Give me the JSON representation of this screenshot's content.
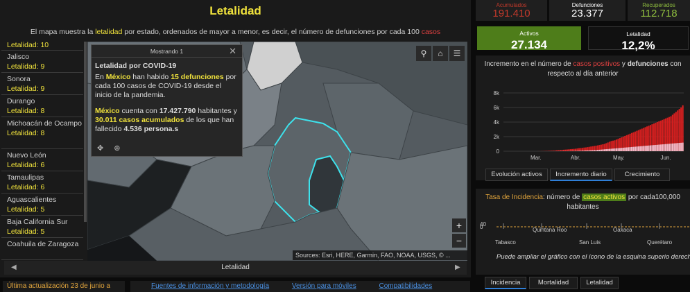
{
  "left": {
    "title": "Letalidad",
    "desc_pre": "El mapa muestra la ",
    "desc_hl": "letalidad",
    "desc_mid": " por estado, ordenados de mayor a menor, es decir, el número de defunciones por cada 100 ",
    "desc_red": "casos",
    "states": [
      {
        "name": "",
        "value": "Letalidad: 10"
      },
      {
        "name": "Jalisco",
        "value": "Letalidad: 9"
      },
      {
        "name": "Sonora",
        "value": "Letalidad: 9"
      },
      {
        "name": "Durango",
        "value": "Letalidad: 8"
      },
      {
        "name": "Michoacán de Ocampo",
        "value": "Letalidad: 8"
      },
      {
        "name": "Nuevo León",
        "value": "Letalidad: 6"
      },
      {
        "name": "Tamaulipas",
        "value": "Letalidad: 6"
      },
      {
        "name": "Aguascalientes",
        "value": "Letalidad: 5"
      },
      {
        "name": "Baja California Sur",
        "value": "Letalidad: 5"
      },
      {
        "name": "Coahuila de Zaragoza",
        "value": ""
      }
    ],
    "bottom_label": "Letalidad",
    "attribution": "Sources: Esri, HERE, Garmin, FAO, NOAA, USGS, © ..."
  },
  "popup": {
    "header": "Mostrando 1",
    "title": "Letalidad por COVID-19",
    "p1_a": "En ",
    "p1_place": "México",
    "p1_b": " han habido ",
    "p1_num": "15 defunciones",
    "p1_c": " por cada 100 casos de COVID-19 desde el inicio de la pandemia.",
    "p2_place": "México",
    "p2_a": " cuenta con ",
    "p2_pop": "17.427.790",
    "p2_b": " habitantes y ",
    "p2_cases": "30.011",
    "p2_cases_lbl": " casos acumulados",
    "p2_c": " de los que han ",
    "p2_d": "fallecido ",
    "p2_deaths": "4.536 persona.s"
  },
  "footer": {
    "update": "Última actualización 23 de junio a",
    "links": [
      "Fuentes de información y metodología",
      "Versión para móviles",
      "Compatibilidades"
    ]
  },
  "kpis": [
    {
      "label": "Acumulados",
      "value": "191.410",
      "color": "#c0392b"
    },
    {
      "label": "Defunciones",
      "value": "23.377",
      "color": "#ffffff"
    },
    {
      "label": "Recuperados",
      "value": "112.718",
      "color": "#8fbf3f"
    }
  ],
  "activos": {
    "label": "Activos",
    "value": "27.134",
    "color": "#4e7d1a"
  },
  "letalidad_box": {
    "label": "Letalidad",
    "value": "12,2%"
  },
  "chart_title": {
    "a": "Incremento  en el número de ",
    "red": "casos positivos",
    "b": " y ",
    "bold": "defunciones",
    "c": " con",
    "line2": "respecto al día anterior"
  },
  "chart_data": {
    "type": "bar",
    "yticks": [
      "8k",
      "6k",
      "4k",
      "2k",
      "0"
    ],
    "xticks": [
      "Mar.",
      "Abr.",
      "May.",
      "Jun."
    ],
    "ylim": [
      0,
      8000
    ],
    "series": [
      {
        "values": [
          0,
          0,
          0,
          0,
          0,
          0,
          0,
          0,
          0,
          0,
          0,
          0,
          0,
          0,
          0,
          0,
          0,
          0,
          0,
          0,
          5,
          10,
          15,
          20,
          30,
          40,
          50,
          60,
          70,
          80,
          100,
          120,
          140,
          160,
          180,
          200,
          220,
          240,
          260,
          280,
          300,
          320,
          340,
          380,
          420,
          440,
          460,
          500,
          520,
          560,
          600,
          640,
          680,
          720,
          760,
          800,
          850,
          900,
          950,
          1000,
          1100,
          1200,
          1300,
          1400,
          1450,
          1500,
          1600,
          1700,
          1800,
          1900,
          2000,
          2100,
          2200,
          2300,
          2400,
          2500,
          2600,
          2700,
          2800,
          2900,
          3000,
          3100,
          3200,
          3300,
          3400,
          3500,
          3600,
          3700,
          3800,
          3900,
          4000,
          4100,
          4200,
          4300,
          4400,
          4500,
          4600,
          4700,
          4800,
          5000,
          5200,
          5400,
          5600,
          5800,
          6000,
          6300
        ],
        "color": "#d41f1f"
      },
      {
        "values": [
          0,
          0,
          0,
          0,
          0,
          0,
          0,
          0,
          0,
          0,
          0,
          0,
          0,
          0,
          0,
          0,
          0,
          0,
          0,
          0,
          0,
          0,
          1,
          1,
          2,
          3,
          4,
          5,
          6,
          8,
          10,
          12,
          14,
          16,
          18,
          20,
          22,
          25,
          28,
          30,
          35,
          40,
          45,
          50,
          60,
          70,
          80,
          90,
          100,
          110,
          120,
          130,
          140,
          150,
          160,
          180,
          200,
          220,
          240,
          260,
          280,
          300,
          320,
          340,
          360,
          380,
          400,
          420,
          440,
          460,
          480,
          500,
          520,
          540,
          560,
          580,
          600,
          620,
          640,
          660,
          680,
          700,
          720,
          740,
          760,
          780,
          800,
          820,
          840,
          860,
          880,
          900,
          920,
          940,
          960,
          980,
          1000,
          1020,
          1040,
          1060,
          1080,
          1100,
          1120,
          1140,
          1160,
          1180
        ],
        "color": "#f2b8c6"
      }
    ]
  },
  "tabs1": [
    "Evolución activos",
    "Incremento diario",
    "Crecimiento"
  ],
  "incidence": {
    "a": "Tasa de Incidencia",
    "b": ": número de ",
    "hl": "casos activos",
    "c": " por cada100,000",
    "line2": "habitantes",
    "yvals": [
      "40",
      "0"
    ],
    "states": [
      "Tabasco",
      "Quintana Roo",
      "San Luis",
      "Oaxaca",
      "Querétaro"
    ],
    "note": "Puede ampliar el gráfico con el ícono de la esquina superio derecha"
  },
  "tabs2": [
    "Incidencia",
    "Mortalidad",
    "Letalidad"
  ]
}
